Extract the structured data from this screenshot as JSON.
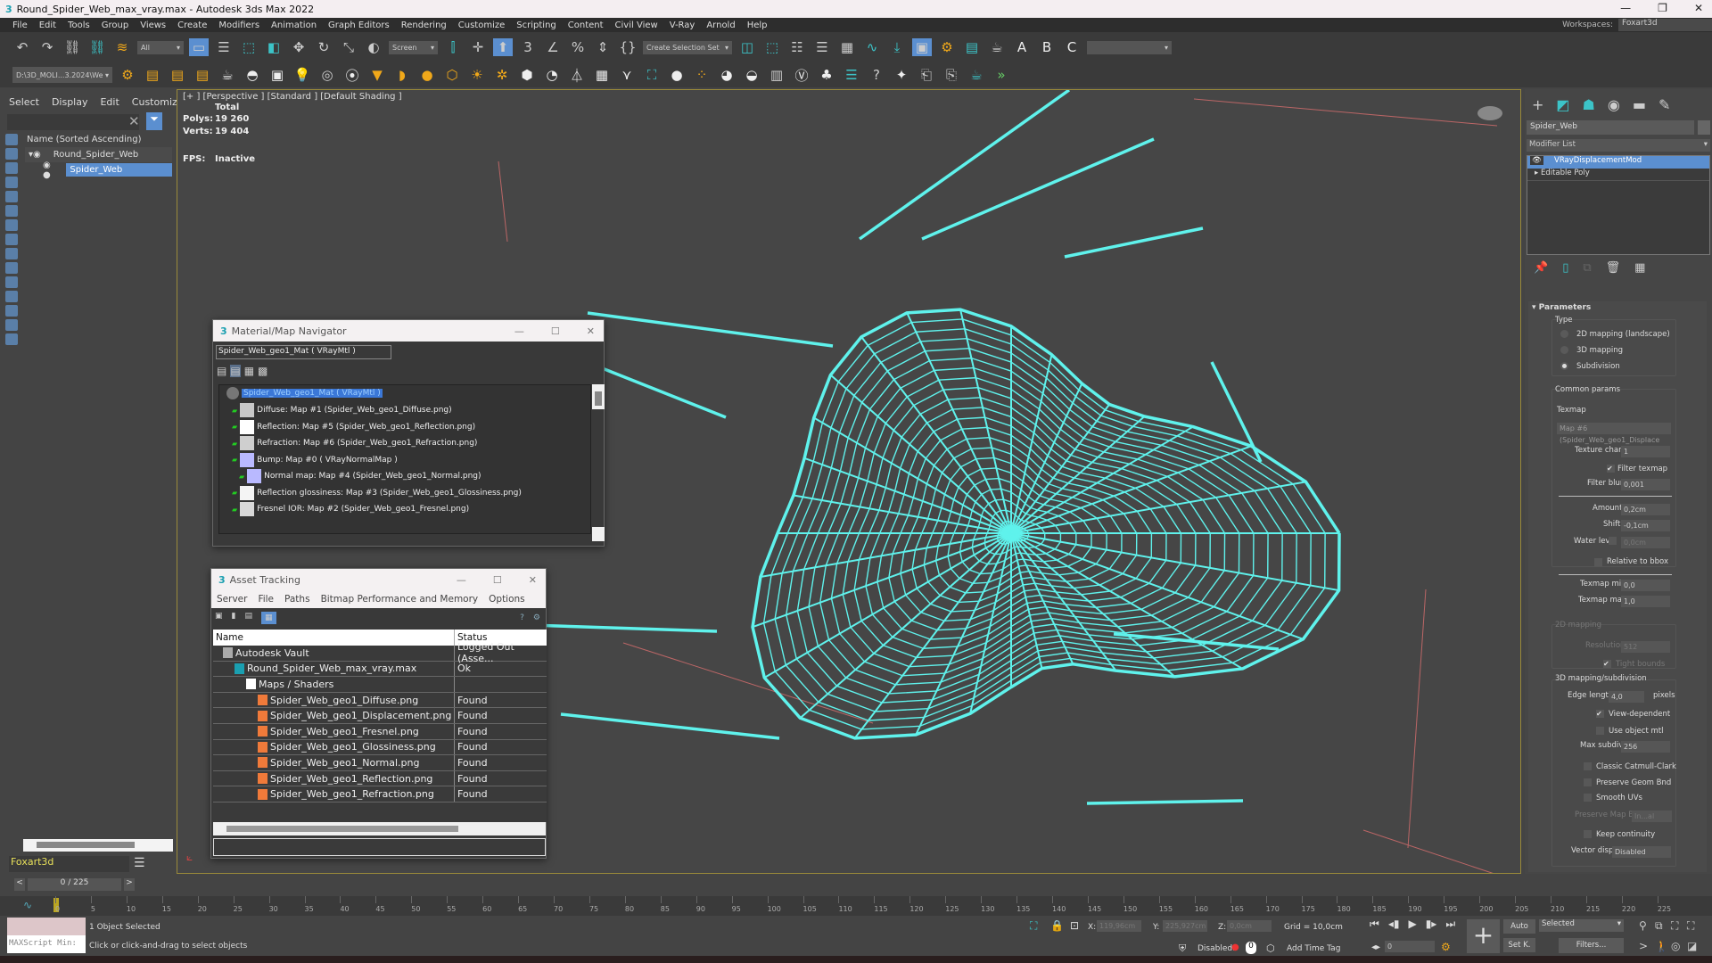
{
  "title": "Round_Spider_Web_max_vray.max - Autodesk 3ds Max 2022",
  "window_controls": {
    "minimize": "—",
    "maximize": "❐",
    "close": "✕"
  },
  "menu": [
    "File",
    "Edit",
    "Tools",
    "Group",
    "Views",
    "Create",
    "Modifiers",
    "Animation",
    "Graph Editors",
    "Rendering",
    "Customize",
    "Scripting",
    "Content",
    "Civil View",
    "V-Ray",
    "Arnold",
    "Help"
  ],
  "workspaces": {
    "label": "Workspaces:",
    "value": "Foxart3d"
  },
  "toolbar": {
    "filter": "All",
    "ref_coord": "Screen",
    "selection_set": "Create Selection Set",
    "project_path": "D:\\3D_MOLI...3.2024\\We"
  },
  "scene_explorer": {
    "tabs": [
      "Select",
      "Display",
      "Edit",
      "Customize"
    ],
    "column": "Name (Sorted Ascending)",
    "items": [
      {
        "name": "Round_Spider_Web"
      },
      {
        "name": "Spider_Web"
      }
    ],
    "layer": "Foxart3d",
    "frame": "0 / 225"
  },
  "viewport": {
    "label": "[+ ] [Perspective ] [Standard ] [Default Shading ]",
    "total": "Total",
    "polys_label": "Polys:",
    "polys": "19 260",
    "verts_label": "Verts:",
    "verts": "19 404",
    "fps_label": "FPS:",
    "fps": "Inactive",
    "web_color": "#5ff2ec"
  },
  "material_navigator": {
    "title": "Material/Map Navigator",
    "field": "Spider_Web_geo1_Mat  ( VRayMtl )",
    "root": "Spider_Web_geo1_Mat  ( VRayMtl )",
    "items": [
      {
        "label": "Diffuse: Map #1 (Spider_Web_geo1_Diffuse.png)",
        "swatch": "#c8c8c8",
        "indent": 0
      },
      {
        "label": "Reflection: Map #5 (Spider_Web_geo1_Reflection.png)",
        "swatch": "#ffffff",
        "indent": 0
      },
      {
        "label": "Refraction: Map #6 (Spider_Web_geo1_Refraction.png)",
        "swatch": "#cfcfcf",
        "indent": 0
      },
      {
        "label": "Bump: Map #0  ( VRayNormalMap )",
        "swatch": "#b9b9ff",
        "indent": 0
      },
      {
        "label": "Normal map: Map #4 (Spider_Web_geo1_Normal.png)",
        "swatch": "#b9b9ff",
        "indent": 1
      },
      {
        "label": "Reflection glossiness: Map #3 (Spider_Web_geo1_Glossiness.png)",
        "swatch": "#f4f4f4",
        "indent": 0
      },
      {
        "label": "Fresnel IOR: Map #2 (Spider_Web_geo1_Fresnel.png)",
        "swatch": "#d8d8d8",
        "indent": 0
      }
    ]
  },
  "asset_tracking": {
    "title": "Asset Tracking",
    "menu": [
      "Server",
      "File",
      "Paths",
      "Bitmap Performance and Memory",
      "Options"
    ],
    "columns": [
      "Name",
      "Status"
    ],
    "rows": [
      {
        "name": "Autodesk Vault",
        "status": "Logged Out (Asse...",
        "indent": 1
      },
      {
        "name": "Round_Spider_Web_max_vray.max",
        "status": "Ok",
        "indent": 2
      },
      {
        "name": "Maps / Shaders",
        "status": "",
        "indent": 3
      },
      {
        "name": "Spider_Web_geo1_Diffuse.png",
        "status": "Found",
        "indent": 4
      },
      {
        "name": "Spider_Web_geo1_Displacement.png",
        "status": "Found",
        "indent": 4
      },
      {
        "name": "Spider_Web_geo1_Fresnel.png",
        "status": "Found",
        "indent": 4
      },
      {
        "name": "Spider_Web_geo1_Glossiness.png",
        "status": "Found",
        "indent": 4
      },
      {
        "name": "Spider_Web_geo1_Normal.png",
        "status": "Found",
        "indent": 4
      },
      {
        "name": "Spider_Web_geo1_Reflection.png",
        "status": "Found",
        "indent": 4
      },
      {
        "name": "Spider_Web_geo1_Refraction.png",
        "status": "Found",
        "indent": 4
      }
    ]
  },
  "modify_panel": {
    "object_name": "Spider_Web",
    "modifier_list": "Modifier List",
    "stack": [
      "VRayDisplacementMod",
      "Editable Poly"
    ],
    "rollout": "Parameters",
    "type_label": "Type",
    "types": [
      "2D mapping (landscape)",
      "3D mapping",
      "Subdivision"
    ],
    "selected_type": "Subdivision",
    "common_params": "Common params",
    "texmap_label": "Texmap",
    "texmap": "Map #6 (Spider_Web_geo1_Displace",
    "texture_chan_label": "Texture chan",
    "texture_chan": "1",
    "filter_texmap": "Filter texmap",
    "filter_blur_label": "Filter blur",
    "filter_blur": "0,001",
    "amount_label": "Amount",
    "amount": "0,2cm",
    "shift_label": "Shift",
    "shift": "-0,1cm",
    "water_level_label": "Water level",
    "water_level": "0,0cm",
    "relative_bbox": "Relative to bbox",
    "texmap_min_label": "Texmap min",
    "texmap_min": "0,0",
    "texmap_max_label": "Texmap max",
    "texmap_max": "1,0",
    "mapping2d": "2D mapping",
    "resolution_label": "Resolution",
    "resolution": "512",
    "tight_bounds": "Tight bounds",
    "mapping3d": "3D mapping/subdivision",
    "edge_length_label": "Edge length",
    "edge_length": "4,0",
    "pixels": "pixels",
    "view_dependent": "View-dependent",
    "use_object_mtl": "Use object mtl",
    "max_subdivs_label": "Max subdivs",
    "max_subdivs": "256",
    "classic_cc": "Classic Catmull-Clark",
    "preserve_geom": "Preserve Geom Bnd",
    "smooth_uvs": "Smooth UVs",
    "preserve_map_label": "Preserve Map Bnd",
    "preserve_map": "In...al",
    "keep_continuity": "Keep continuity",
    "vector_displ_label": "Vector displ",
    "vector_displ": "Disabled"
  },
  "timeline": {
    "ticks": [
      0,
      5,
      10,
      15,
      20,
      25,
      30,
      35,
      40,
      45,
      50,
      55,
      60,
      65,
      70,
      75,
      80,
      85,
      90,
      95,
      100,
      105,
      110,
      115,
      120,
      125,
      130,
      135,
      140,
      145,
      150,
      155,
      160,
      165,
      170,
      175,
      180,
      185,
      190,
      195,
      200,
      205,
      210,
      215,
      220,
      225
    ]
  },
  "status": {
    "maxscript": "MAXScript Min:",
    "selected": "1 Object Selected",
    "prompt": "Click or click-and-drag to select objects",
    "x_label": "X:",
    "x": "119,96cm",
    "y_label": "Y:",
    "y": "225,927cm",
    "z_label": "Z:",
    "z": "0,0cm",
    "grid": "Grid = 10,0cm",
    "disabled": "Disabled:",
    "add_time_tag": "Add Time Tag",
    "frame": "0",
    "auto": "Auto",
    "setk": "Set K.",
    "key_filter": "Selected",
    "filters": "Filters..."
  }
}
